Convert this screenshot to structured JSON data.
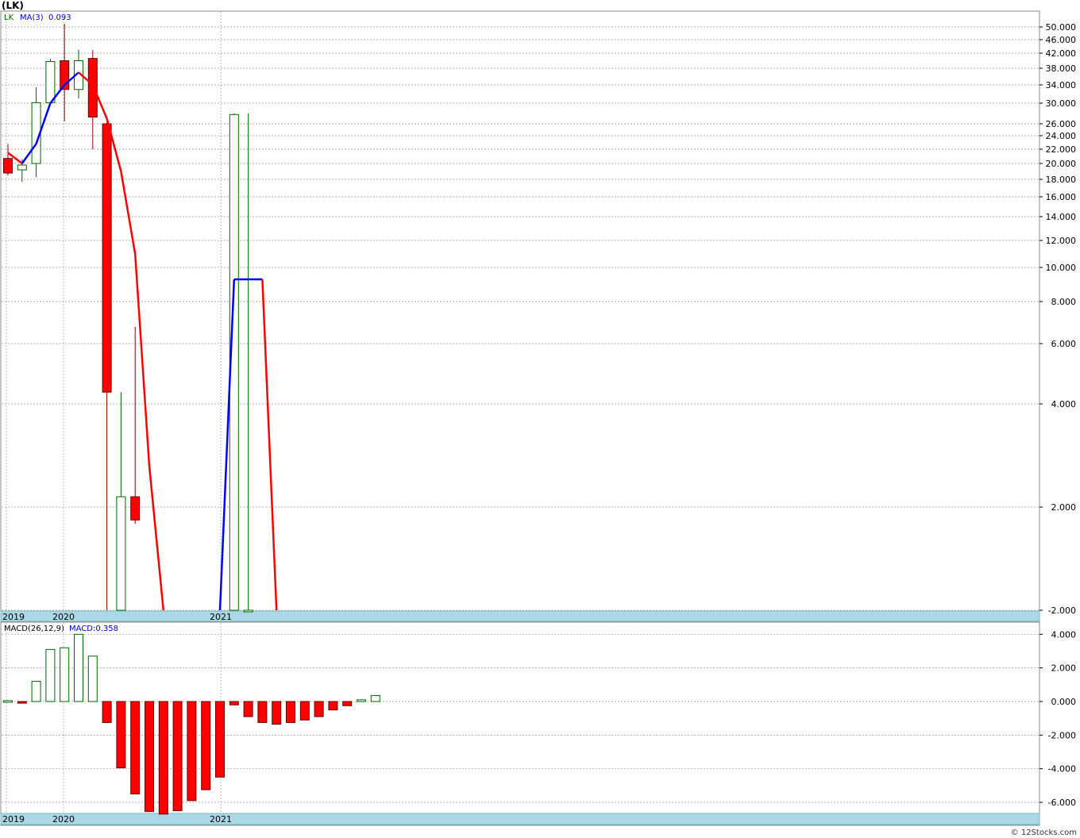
{
  "header": {
    "title": "(LK)",
    "credit": "© 12Stocks.com"
  },
  "chart_data": [
    {
      "type": "candlestick",
      "legend": {
        "symbol": "LK",
        "ma_label": "MA(3)",
        "ma_value": "0.093"
      },
      "y_tick_labels": [
        "50.000",
        "46.000",
        "42.000",
        "38.000",
        "34.000",
        "30.000",
        "26.000",
        "24.000",
        "22.000",
        "20.000",
        "18.000",
        "16.000",
        "14.000",
        "12.000",
        "10.000",
        "8.000",
        "6.000",
        "4.000",
        "2.000",
        "-2.000"
      ],
      "x_tick_labels": [
        "2019",
        "2020",
        "2021"
      ],
      "candles": [
        {
          "o": 20.7,
          "h": 22.8,
          "l": 18.5,
          "c": 18.8
        },
        {
          "o": 19.2,
          "h": 20.6,
          "l": 17.7,
          "c": 19.8
        },
        {
          "o": 20.0,
          "h": 33.5,
          "l": 18.3,
          "c": 30.1
        },
        {
          "o": 30.1,
          "h": 40.5,
          "l": 29.8,
          "c": 39.8
        },
        {
          "o": 40.0,
          "h": 51.0,
          "l": 26.5,
          "c": 33.0
        },
        {
          "o": 33.0,
          "h": 43.0,
          "l": 31.0,
          "c": 40.0
        },
        {
          "o": 40.6,
          "h": 42.9,
          "l": 22.0,
          "c": 27.3
        },
        {
          "o": 26.0,
          "h": 26.3,
          "l": -2.0,
          "c": 4.39
        },
        {
          "o": -2.0,
          "h": 4.39,
          "l": -2.0,
          "c": 2.2
        },
        {
          "o": 2.2,
          "h": 6.8,
          "l": 1.35,
          "c": 1.5
        },
        null,
        null,
        null,
        null,
        null,
        null,
        {
          "o": -2.0,
          "h": 28.0,
          "l": -2.0,
          "c": 27.8
        },
        {
          "o": -2.0,
          "h": 28.0,
          "l": -2.0,
          "c": -2.0
        }
      ],
      "ma3": [
        21.5,
        20.0,
        22.8,
        30.0,
        34.0,
        37.0,
        34.0,
        27.0,
        19.0,
        11.0,
        2.8,
        -2.0,
        -2.0,
        -2.0,
        -2.0,
        -2.0,
        9.3,
        9.3,
        9.3,
        -2.0
      ]
    },
    {
      "type": "bar",
      "legend": {
        "label": "MACD(26,12,9)",
        "value_label": "MACD:0.358"
      },
      "y_tick_labels": [
        "4.000",
        "2.000",
        "0.000",
        "-2.000",
        "-4.000",
        "-6.000"
      ],
      "x_tick_labels": [
        "2019",
        "2020",
        "2021"
      ],
      "values": [
        0.05,
        -0.1,
        1.2,
        3.1,
        3.2,
        4.0,
        2.7,
        -1.25,
        -3.95,
        -5.5,
        -6.55,
        -6.7,
        -6.5,
        -5.9,
        -5.25,
        -4.5,
        -0.2,
        -0.9,
        -1.25,
        -1.35,
        -1.25,
        -1.1,
        -0.9,
        -0.5,
        -0.25,
        0.1,
        0.358
      ]
    }
  ]
}
